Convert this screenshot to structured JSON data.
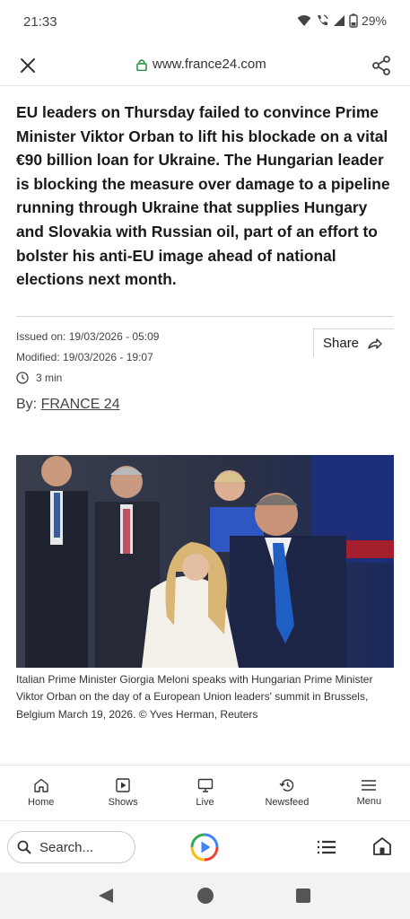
{
  "status": {
    "time": "21:33",
    "battery": "29%"
  },
  "browser": {
    "url": "www.france24.com",
    "search_placeholder": "Search..."
  },
  "article": {
    "lead": "EU leaders on Thursday failed to convince Prime Minister Viktor Orban to lift his blockade on a vital €90 billion loan for Ukraine. The Hungarian leader is blocking the measure over damage to a pipeline running through Ukraine that supplies Hungary and Slovakia with Russian oil, part of an effort to bolster his anti-EU image ahead of national elections next month.",
    "issued": "Issued on: 19/03/2026 - 05:09",
    "modified": "Modified: 19/03/2026 - 19:07",
    "read_time": "3 min",
    "share_label": "Share",
    "by_label": "By:",
    "author": "FRANCE 24",
    "caption": "Italian Prime Minister Giorgia Meloni speaks with Hungarian Prime Minister Viktor Orban on the day of a European Union leaders' summit in Brussels, Belgium March 19, 2026. © Yves Herman, Reuters"
  },
  "bottom_nav": {
    "items": [
      {
        "label": "Home",
        "icon": "home-icon"
      },
      {
        "label": "Shows",
        "icon": "play-icon"
      },
      {
        "label": "Live",
        "icon": "tv-icon"
      },
      {
        "label": "Newsfeed",
        "icon": "history-icon"
      },
      {
        "label": "Menu",
        "icon": "menu-icon"
      }
    ]
  },
  "colors": {
    "lock": "#1e8e3e",
    "text": "#1a1a1a",
    "muted": "#444444",
    "photo_blue_tie": "#1f5fc4"
  }
}
